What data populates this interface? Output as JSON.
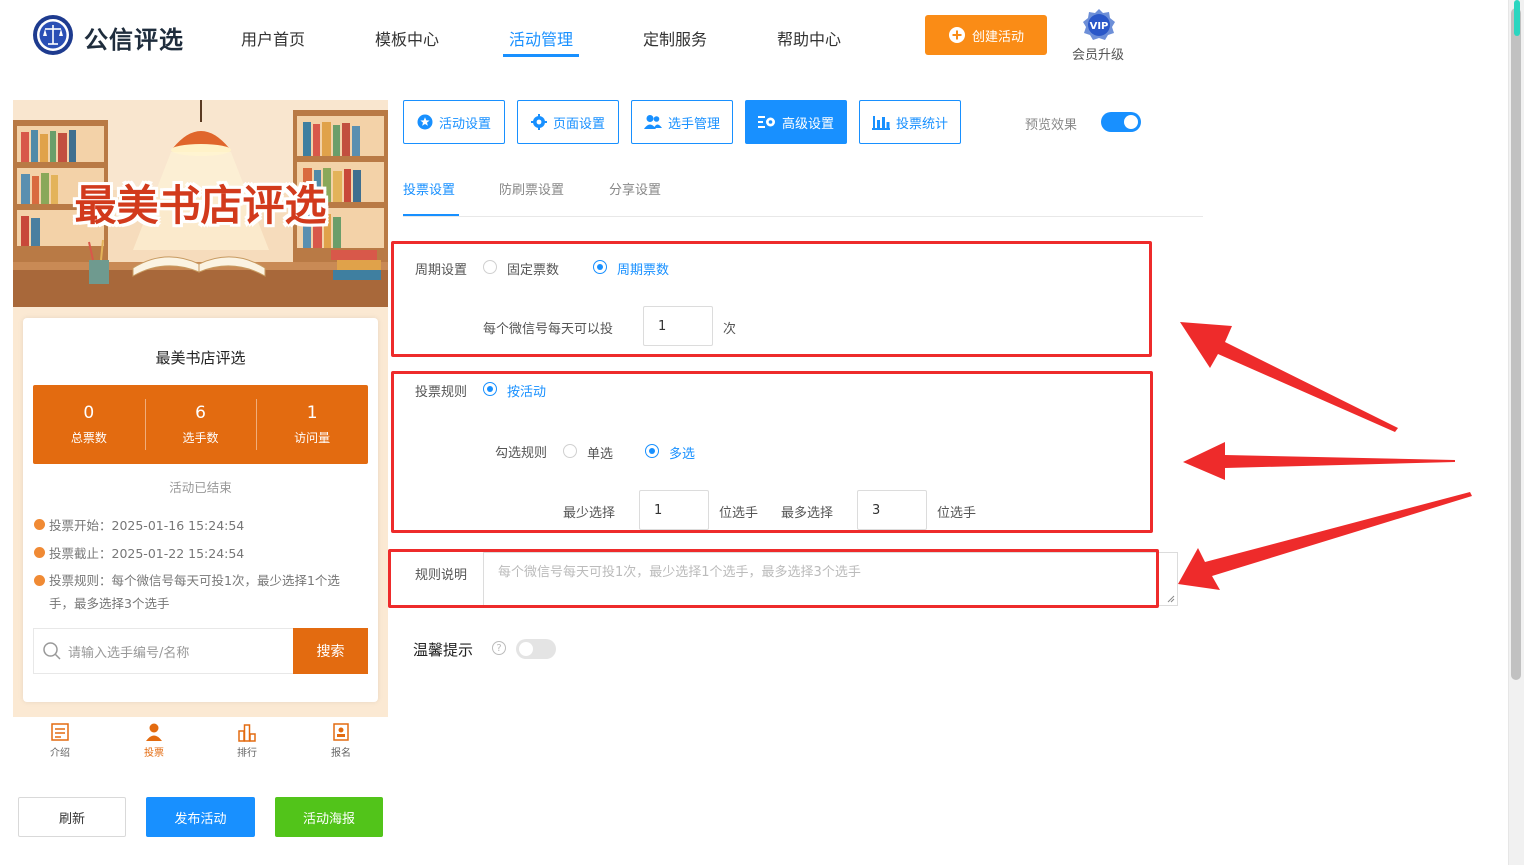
{
  "header": {
    "brand": "公信评选",
    "nav": [
      "用户首页",
      "模板中心",
      "活动管理",
      "定制服务",
      "帮助中心"
    ],
    "active_nav": "活动管理",
    "create_button": "创建活动",
    "vip_badge": "VIP",
    "vip_label": "会员升级"
  },
  "preview": {
    "banner_title": "最美书店评选",
    "activity_title": "最美书店评选",
    "stats": [
      {
        "value": "0",
        "label": "总票数"
      },
      {
        "value": "6",
        "label": "选手数"
      },
      {
        "value": "1",
        "label": "访问量"
      }
    ],
    "status": "活动已结束",
    "vote_start": "投票开始：2025-01-16 15:24:54",
    "vote_end": "投票截止：2025-01-22 15:24:54",
    "vote_rule": "投票规则：每个微信号每天可投1次，最少选择1个选手，最多选择3个选手",
    "search_placeholder": "请输入选手编号/名称",
    "search_button": "搜索",
    "tabbar": [
      "介绍",
      "投票",
      "排行",
      "报名"
    ],
    "active_tab": "投票"
  },
  "actions": {
    "refresh": "刷新",
    "publish": "发布活动",
    "poster": "活动海报"
  },
  "settings_tabs": [
    "活动设置",
    "页面设置",
    "选手管理",
    "高级设置",
    "投票统计"
  ],
  "active_settings_tab": "高级设置",
  "preview_toggle_label": "预览效果",
  "preview_toggle_on": true,
  "subtabs": [
    "投票设置",
    "防刷票设置",
    "分享设置"
  ],
  "active_subtab": "投票设置",
  "period": {
    "label": "周期设置",
    "options": [
      "固定票数",
      "周期票数"
    ],
    "selected": "周期票数",
    "per_day_label": "每个微信号每天可以投",
    "per_day_value": "1",
    "per_day_unit": "次"
  },
  "rules": {
    "label": "投票规则",
    "option": "按活动",
    "check_label": "勾选规则",
    "check_options": [
      "单选",
      "多选"
    ],
    "check_selected": "多选",
    "min_label": "最少选择",
    "min_value": "1",
    "min_unit": "位选手",
    "max_label": "最多选择",
    "max_value": "3",
    "max_unit": "位选手"
  },
  "rule_desc": {
    "label": "规则说明",
    "placeholder": "每个微信号每天可投1次，最少选择1个选手，最多选择3个选手"
  },
  "tips": {
    "label": "温馨提示",
    "help": "?",
    "on": false
  },
  "colors": {
    "primary": "#1890ff",
    "orange": "#fa8c16",
    "card_orange": "#e36b10",
    "green": "#52c41a",
    "highlight_red": "#ee2b2b"
  }
}
